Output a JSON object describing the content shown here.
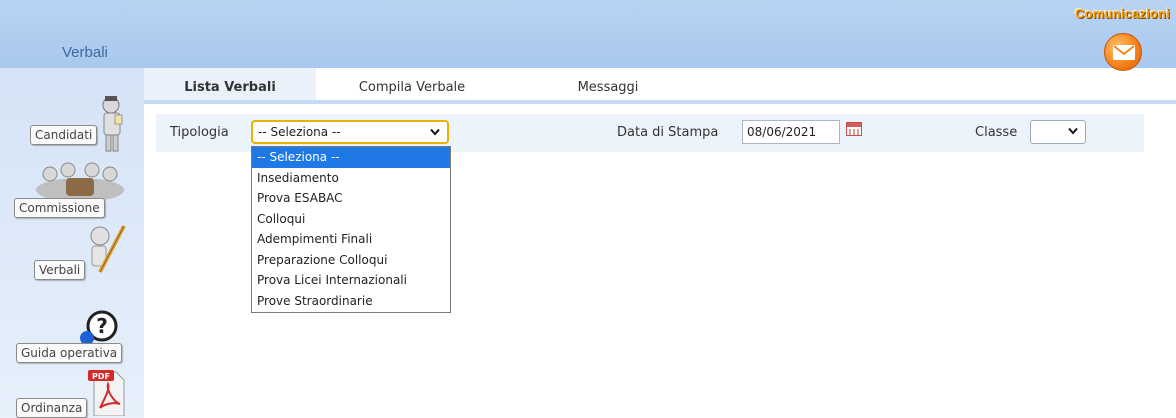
{
  "header": {
    "app_title": "Verbali",
    "comunicazioni_label": "Comunicazioni",
    "accent_color": "#f4a21c",
    "mail_icon": "envelope-icon"
  },
  "sidebar": {
    "items": [
      {
        "label": "Candidati",
        "icon": "person-icon"
      },
      {
        "label": "Commissione",
        "icon": "group-icon"
      },
      {
        "label": "Verbali",
        "icon": "pen-icon"
      },
      {
        "label": "Guida operativa",
        "icon": "help-icon"
      },
      {
        "label": "Ordinanza",
        "icon": "pdf-icon"
      }
    ]
  },
  "tabs": [
    {
      "label": "Lista Verbali",
      "active": true
    },
    {
      "label": "Compila Verbale",
      "active": false
    },
    {
      "label": "Messaggi",
      "active": false
    }
  ],
  "filters": {
    "tipologia_label": "Tipologia",
    "tipologia_value": "-- Seleziona --",
    "data_stampa_label": "Data di Stampa",
    "data_stampa_value": "08/06/2021",
    "classe_label": "Classe",
    "classe_value": ""
  },
  "dropdown": {
    "options": [
      "-- Seleziona --",
      "Insediamento",
      "Prova ESABAC",
      "Colloqui",
      "Adempimenti Finali",
      "Preparazione Colloqui",
      "Prova Licei Internazionali",
      "Prove Straordinarie"
    ],
    "selected_index": 0
  }
}
